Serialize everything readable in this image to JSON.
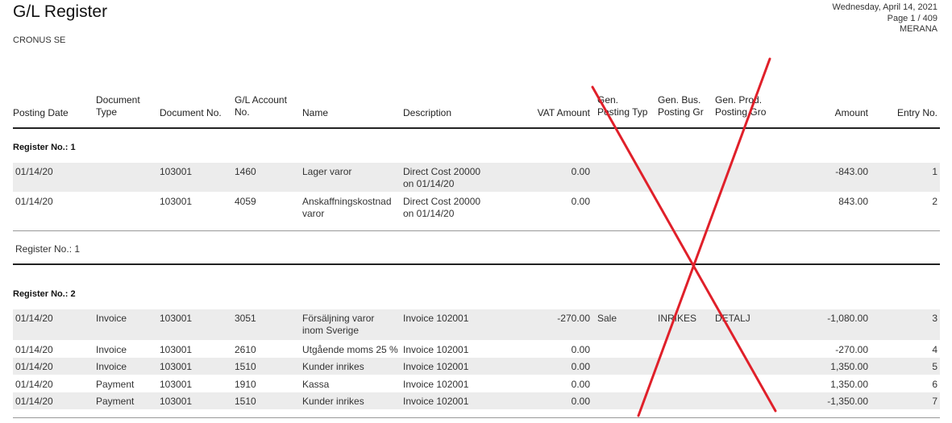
{
  "report": {
    "title": "G/L Register",
    "company": "CRONUS SE",
    "date": "Wednesday, April 14, 2021",
    "page": "Page 1 / 409",
    "user": "MERANA"
  },
  "columns": {
    "posting_date": "Posting Date",
    "document_type": [
      "Document",
      "Type"
    ],
    "document_no": "Document No.",
    "gl_account_no": [
      "G/L Account",
      "No."
    ],
    "name": "Name",
    "description": "Description",
    "vat_amount": "VAT Amount",
    "gen_posting_type": [
      "Gen.",
      "Posting Typ"
    ],
    "gen_bus_posting_group": [
      "Gen. Bus.",
      "Posting Gr"
    ],
    "gen_prod_posting_group": [
      "Gen. Prod.",
      "Posting Gro"
    ],
    "amount": "Amount",
    "entry_no": "Entry No."
  },
  "registers": [
    {
      "title": "Register No.: 1",
      "footer": "Register No.: 1",
      "rows": [
        {
          "date": "01/14/20",
          "type": "",
          "doc": "103001",
          "acct": "1460",
          "name": [
            "Lager varor"
          ],
          "desc": [
            "Direct Cost 20000",
            "on 01/14/20"
          ],
          "vat": "0.00",
          "gpt": "",
          "gbpg": "",
          "gppg": "",
          "amount": "-843.00",
          "entry": "1"
        },
        {
          "date": "01/14/20",
          "type": "",
          "doc": "103001",
          "acct": "4059",
          "name": [
            "Anskaffningskostnad",
            "varor"
          ],
          "desc": [
            "Direct Cost 20000",
            "on 01/14/20"
          ],
          "vat": "0.00",
          "gpt": "",
          "gbpg": "",
          "gppg": "",
          "amount": "843.00",
          "entry": "2"
        }
      ]
    },
    {
      "title": "Register No.: 2",
      "rows": [
        {
          "date": "01/14/20",
          "type": "Invoice",
          "doc": "103001",
          "acct": "3051",
          "name": [
            "Försäljning varor",
            "inom Sverige"
          ],
          "desc": [
            "Invoice 102001"
          ],
          "vat": "-270.00",
          "gpt": "Sale",
          "gbpg": "INRIKES",
          "gppg": "DETALJ",
          "amount": "-1,080.00",
          "entry": "3"
        },
        {
          "date": "01/14/20",
          "type": "Invoice",
          "doc": "103001",
          "acct": "2610",
          "name": [
            "Utgående moms 25 %"
          ],
          "desc": [
            "Invoice 102001"
          ],
          "vat": "0.00",
          "gpt": "",
          "gbpg": "",
          "gppg": "",
          "amount": "-270.00",
          "entry": "4"
        },
        {
          "date": "01/14/20",
          "type": "Invoice",
          "doc": "103001",
          "acct": "1510",
          "name": [
            "Kunder inrikes"
          ],
          "desc": [
            "Invoice 102001"
          ],
          "vat": "0.00",
          "gpt": "",
          "gbpg": "",
          "gppg": "",
          "amount": "1,350.00",
          "entry": "5"
        },
        {
          "date": "01/14/20",
          "type": "Payment",
          "doc": "103001",
          "acct": "1910",
          "name": [
            "Kassa"
          ],
          "desc": [
            "Invoice 102001"
          ],
          "vat": "0.00",
          "gpt": "",
          "gbpg": "",
          "gppg": "",
          "amount": "1,350.00",
          "entry": "6"
        },
        {
          "date": "01/14/20",
          "type": "Payment",
          "doc": "103001",
          "acct": "1510",
          "name": [
            "Kunder inrikes"
          ],
          "desc": [
            "Invoice 102001"
          ],
          "vat": "0.00",
          "gpt": "",
          "gbpg": "",
          "gppg": "",
          "amount": "-1,350.00",
          "entry": "7"
        }
      ]
    }
  ],
  "annotation": {
    "color": "#e0202a"
  }
}
